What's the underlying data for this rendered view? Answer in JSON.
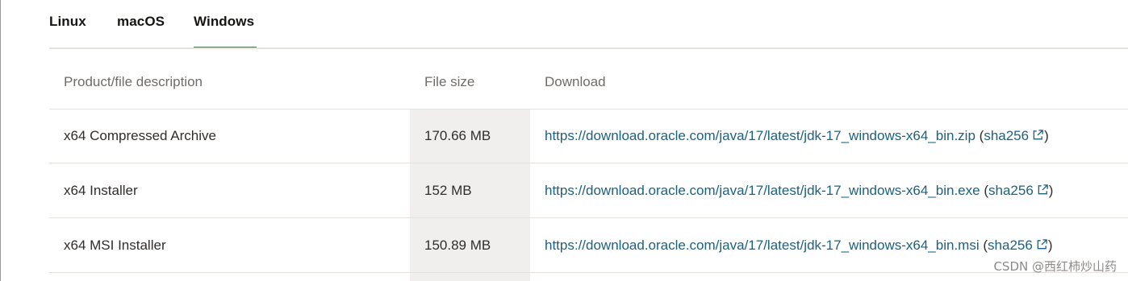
{
  "tabs": [
    {
      "label": "Linux"
    },
    {
      "label": "macOS"
    },
    {
      "label": "Windows",
      "active": true
    }
  ],
  "table": {
    "headers": [
      "Product/file description",
      "File size",
      "Download"
    ],
    "rows": [
      {
        "description": "x64 Compressed Archive",
        "size": "170.66 MB",
        "url": "https://download.oracle.com/java/17/latest/jdk-17_windows-x64_bin.zip",
        "checksum": "sha256"
      },
      {
        "description": "x64 Installer",
        "size": "152 MB",
        "url": "https://download.oracle.com/java/17/latest/jdk-17_windows-x64_bin.exe",
        "checksum": "sha256"
      },
      {
        "description": "x64 MSI Installer",
        "size": "150.89 MB",
        "url": "https://download.oracle.com/java/17/latest/jdk-17_windows-x64_bin.msi",
        "checksum": "sha256"
      }
    ]
  },
  "paren_open": "(",
  "paren_close": ")",
  "watermark": "CSDN @西红柿炒山药",
  "colors": {
    "accent": "#4f6f52",
    "link": "#1b6182",
    "shade": "#f1efed"
  },
  "icons": {
    "external": "external-link-icon"
  }
}
